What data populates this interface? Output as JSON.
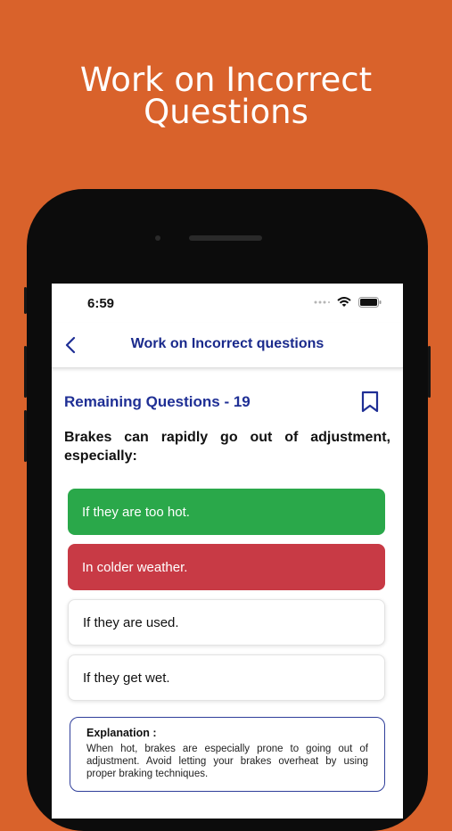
{
  "hero": {
    "line1": "Work on Incorrect",
    "line2": "Questions"
  },
  "status_bar": {
    "time": "6:59",
    "icons": [
      "signal-icon",
      "wifi-icon",
      "battery-icon"
    ]
  },
  "nav": {
    "back_icon": "chevron-left-icon",
    "title": "Work on Incorrect questions"
  },
  "quiz": {
    "remaining_label": "Remaining Questions - 19",
    "bookmark_icon": "bookmark-icon",
    "question": "Brakes can rapidly go out of adjustment, especially:",
    "options": [
      {
        "text": "If they are too hot.",
        "state": "correct"
      },
      {
        "text": "In colder weather.",
        "state": "incorrect"
      },
      {
        "text": "If they are used.",
        "state": "neutral"
      },
      {
        "text": "If they get wet.",
        "state": "neutral"
      }
    ],
    "explanation": {
      "title": "Explanation :",
      "text": "When hot, brakes are especially prone to going out of adjustment. Avoid letting your brakes overheat by using proper braking techniques."
    }
  },
  "colors": {
    "background": "#d9622b",
    "accent": "#1f2f95",
    "correct": "#2aa84a",
    "incorrect": "#c83a45"
  }
}
